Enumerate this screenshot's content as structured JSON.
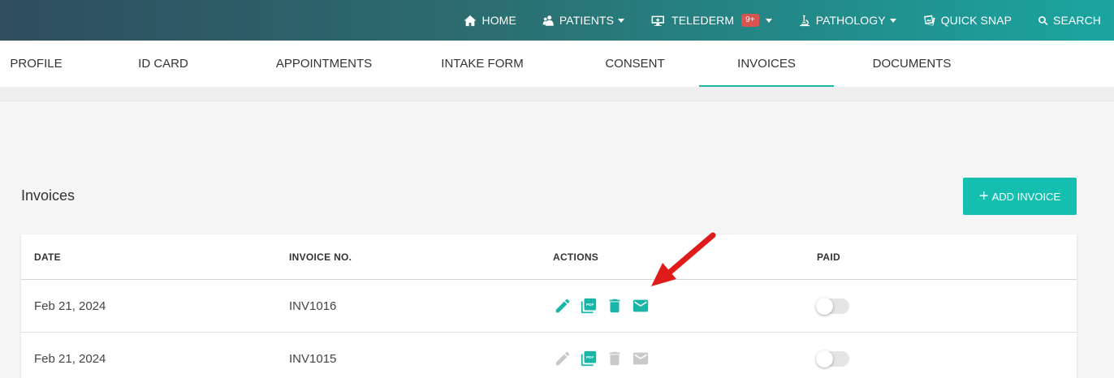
{
  "nav": {
    "home": "HOME",
    "patients": "PATIENTS",
    "telederm": "TELEDERM",
    "telederm_badge": "9+",
    "pathology": "PATHOLOGY",
    "quick_snap": "QUICK SNAP",
    "search": "SEARCH"
  },
  "tabs": [
    {
      "label": "PROFILE"
    },
    {
      "label": "ID CARD"
    },
    {
      "label": "APPOINTMENTS"
    },
    {
      "label": "INTAKE FORM"
    },
    {
      "label": "CONSENT"
    },
    {
      "label": "INVOICES",
      "active": true
    },
    {
      "label": "DOCUMENTS"
    }
  ],
  "section": {
    "title": "Invoices",
    "add_label": "ADD INVOICE"
  },
  "table": {
    "headers": {
      "date": "DATE",
      "invoice_no": "INVOICE NO.",
      "actions": "ACTIONS",
      "paid": "PAID"
    },
    "rows": [
      {
        "date": "Feb 21, 2024",
        "invoice_no": "INV1016",
        "actions_enabled": true,
        "paid": false
      },
      {
        "date": "Feb 21, 2024",
        "invoice_no": "INV1015",
        "actions_enabled": false,
        "paid": false
      }
    ]
  },
  "colors": {
    "accent": "#14bfb0",
    "badge": "#d9534f",
    "annotation_arrow": "#e01b1b"
  }
}
